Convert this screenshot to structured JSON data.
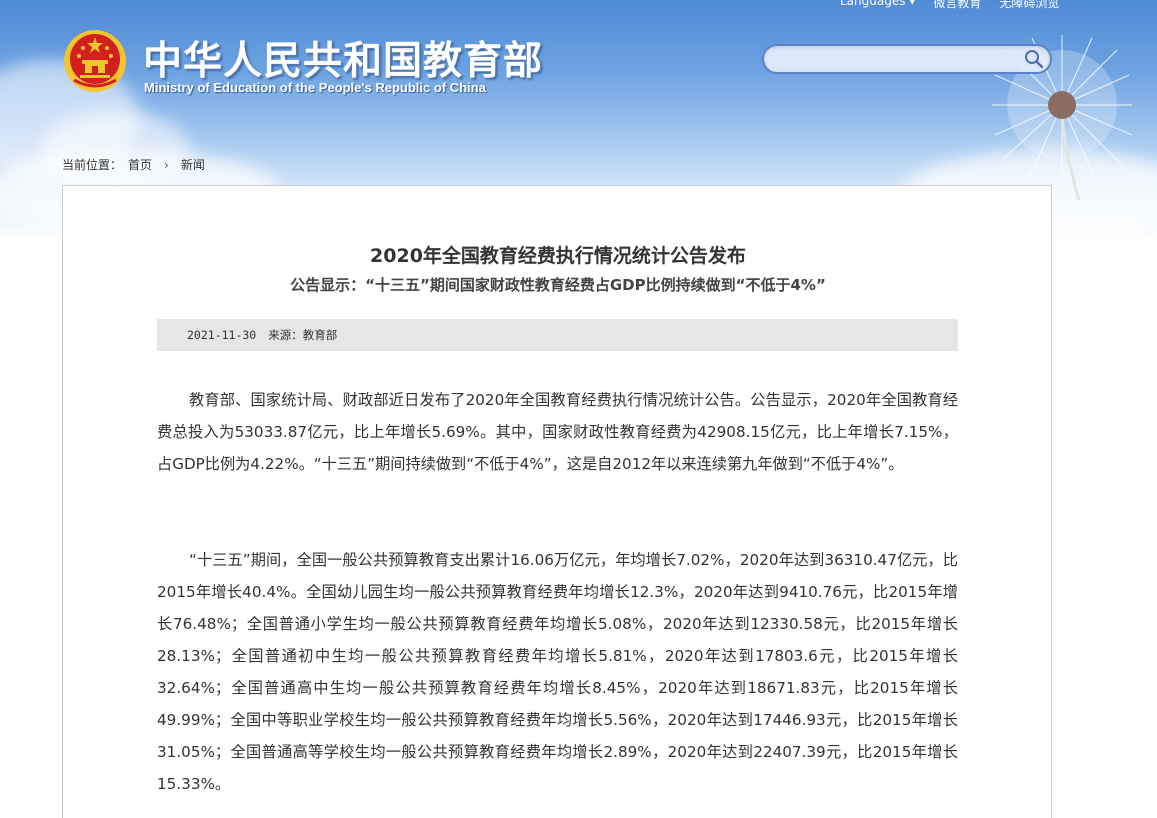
{
  "header": {
    "title_cn": "中华人民共和国教育部",
    "title_en": "Ministry of Education of the People's Republic of China",
    "top_links": [
      "Languages ▾",
      "微言教育",
      "无障碍浏览"
    ]
  },
  "search": {
    "placeholder": ""
  },
  "breadcrumb": {
    "label": "当前位置：",
    "home": "首页",
    "separator": ">",
    "current": "新闻"
  },
  "article": {
    "title": "2020年全国教育经费执行情况统计公告发布",
    "subtitle": "公告显示：“十三五”期间国家财政性教育经费占GDP比例持续做到“不低于4%”",
    "date": "2021-11-30",
    "source": "来源：教育部",
    "paragraphs": [
      "教育部、国家统计局、财政部近日发布了2020年全国教育经费执行情况统计公告。公告显示，2020年全国教育经费总投入为53033.87亿元，比上年增长5.69%。其中，国家财政性教育经费为42908.15亿元，比上年增长7.15%，占GDP比例为4.22%。“十三五”期间持续做到“不低于4%”，这是自2012年以来连续第九年做到“不低于4%”。",
      "“十三五”期间，全国一般公共预算教育支出累计16.06万亿元，年均增长7.02%，2020年达到36310.47亿元，比2015年增长40.4%。全国幼儿园生均一般公共预算教育经费年均增长12.3%，2020年达到9410.76元，比2015年增长76.48%；全国普通小学生均一般公共预算教育经费年均增长5.08%，2020年达到12330.58元，比2015年增长28.13%；全国普通初中生均一般公共预算教育经费年均增长5.81%，2020年达到17803.6元，比2015年增长32.64%；全国普通高中生均一般公共预算教育经费年均增长8.45%，2020年达到18671.83元，比2015年增长49.99%；全国中等职业学校生均一般公共预算教育经费年均增长5.56%，2020年达到17446.93元，比2015年增长31.05%；全国普通高等学校生均一般公共预算教育经费年均增长2.89%，2020年达到22407.39元，比2015年增长15.33%。"
    ]
  },
  "icons": {
    "emblem": "national-emblem-icon",
    "search": "search-icon",
    "chevron": "chevron-right-icon"
  },
  "colors": {
    "header_blue": "#4f8ad6",
    "emblem_red": "#d21f1f",
    "emblem_gold": "#f5c431",
    "meta_bar": "#e6e6e6",
    "text": "#333333"
  }
}
